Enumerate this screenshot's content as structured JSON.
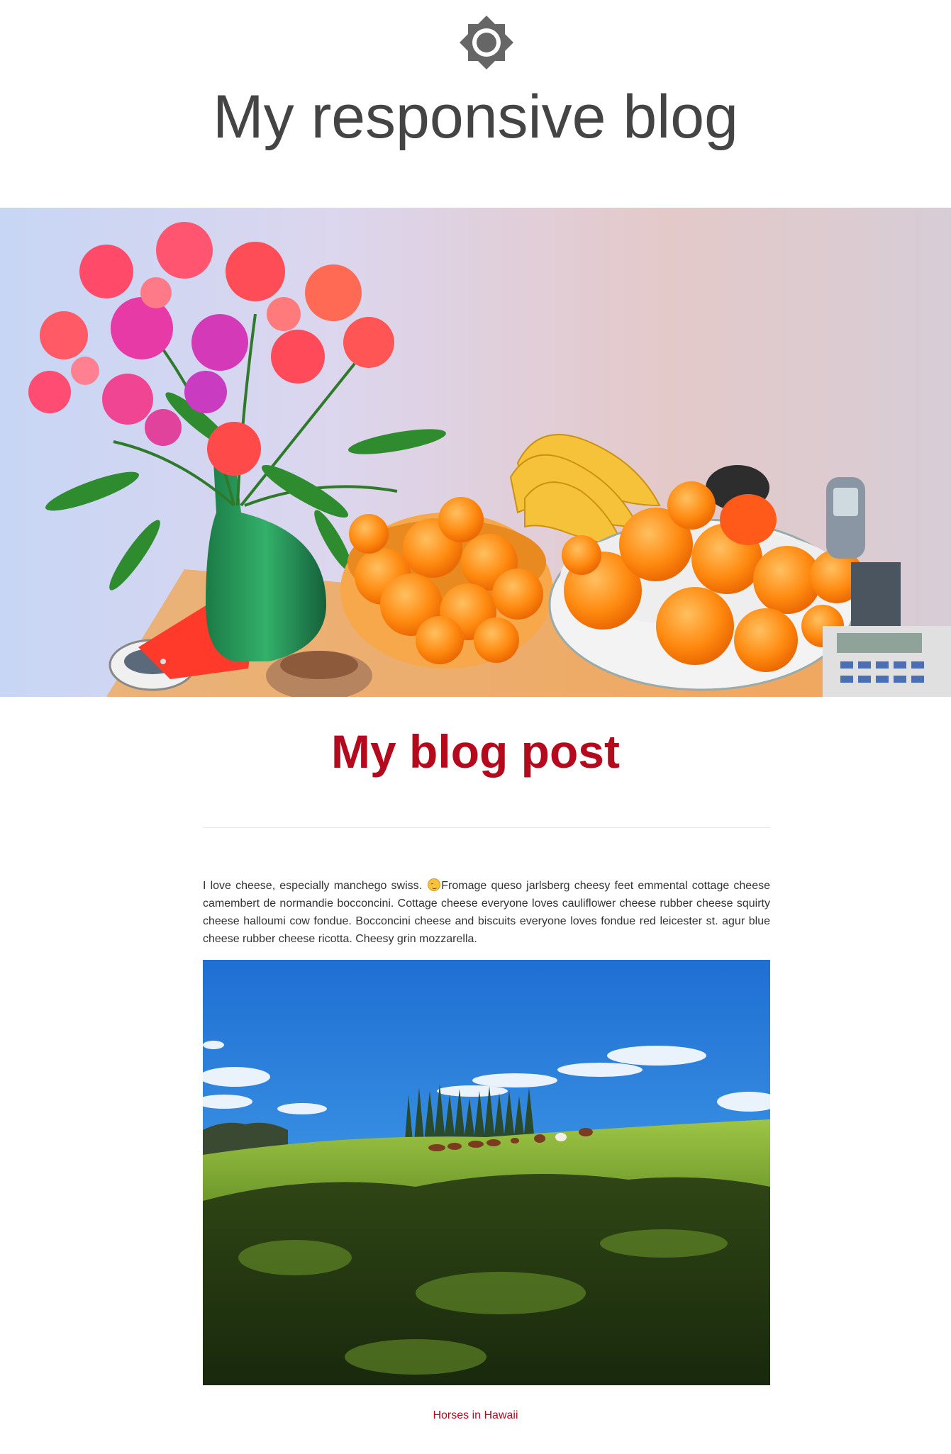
{
  "header": {
    "logo_icon": "gear-sun-icon",
    "title": "My responsive blog"
  },
  "hero": {
    "subject": "flowers-and-fruit-still-life"
  },
  "post": {
    "title": "My blog post",
    "body_before_emoji": "I love cheese, especially manchego swiss.",
    "emoji_icon": "relieved-face-emoji",
    "body_after_emoji": "Fromage queso jarlsberg cheesy feet emmental cottage cheese camembert de normandie bocconcini. Cottage cheese everyone loves cauliflower cheese rubber cheese squirty cheese halloumi cow fondue. Bocconcini cheese and biscuits everyone loves fondue red leicester st. agur blue cheese rubber cheese ricotta. Cheesy grin mozzarella.",
    "figure_caption": "Horses in Hawaii"
  },
  "colors": {
    "title_text": "#444444",
    "accent": "#b5091e",
    "logo": "#666666",
    "divider": "#e6e6e6"
  }
}
